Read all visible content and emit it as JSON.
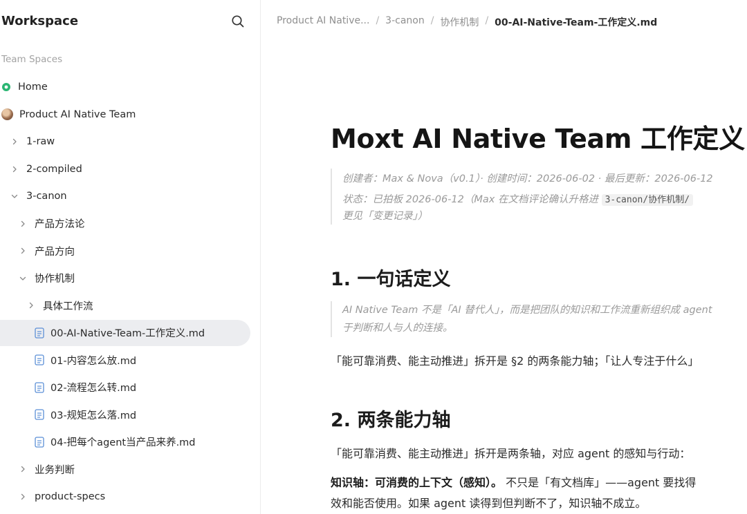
{
  "sidebar": {
    "workspace_title": "Workspace",
    "section_label": "Team Spaces",
    "items": [
      {
        "label": "Home",
        "kind": "home",
        "indent": 0,
        "chevron": "none"
      },
      {
        "label": "Product AI Native Team",
        "kind": "team",
        "indent": 0,
        "chevron": "none"
      },
      {
        "label": "1-raw",
        "kind": "folder",
        "indent": 1,
        "chevron": "right"
      },
      {
        "label": "2-compiled",
        "kind": "folder",
        "indent": 1,
        "chevron": "right"
      },
      {
        "label": "3-canon",
        "kind": "folder",
        "indent": 1,
        "chevron": "down"
      },
      {
        "label": "产品方法论",
        "kind": "folder",
        "indent": 2,
        "chevron": "right"
      },
      {
        "label": "产品方向",
        "kind": "folder",
        "indent": 2,
        "chevron": "right"
      },
      {
        "label": "协作机制",
        "kind": "folder",
        "indent": 2,
        "chevron": "down"
      },
      {
        "label": "具体工作流",
        "kind": "folder",
        "indent": 3,
        "chevron": "right"
      },
      {
        "label": "00-AI-Native-Team-工作定义.md",
        "kind": "file",
        "indent": 3,
        "active": true
      },
      {
        "label": "01-内容怎么放.md",
        "kind": "file",
        "indent": 3
      },
      {
        "label": "02-流程怎么转.md",
        "kind": "file",
        "indent": 3
      },
      {
        "label": "03-规矩怎么落.md",
        "kind": "file",
        "indent": 3
      },
      {
        "label": "04-把每个agent当产品来养.md",
        "kind": "file",
        "indent": 3
      },
      {
        "label": "业务判断",
        "kind": "folder",
        "indent": 2,
        "chevron": "right"
      },
      {
        "label": "product-specs",
        "kind": "folder",
        "indent": 2,
        "chevron": "right"
      }
    ]
  },
  "breadcrumb": {
    "items": [
      "Product AI Native...",
      "3-canon",
      "协作机制"
    ],
    "separator": "/",
    "current": "00-AI-Native-Team-工作定义.md"
  },
  "doc": {
    "title": "Moxt AI Native Team 工作定义",
    "meta_line1": "创建者：Max & Nova（v0.1）· 创建时间：2026-06-02 · 最后更新：2026-06-12",
    "meta_line2_prefix": "状态：已拍板 2026-06-12（Max 在文档评论确认升格进 ",
    "meta_line2_code": "3-canon/协作机制/",
    "meta_line3": "更见「变更记录」）",
    "h1": "1. 一句话定义",
    "quote_line1": "AI Native Team 不是「AI 替代人」，而是把团队的知识和工作流重新组织成 agent",
    "quote_line2": "于判断和人与人的连接。",
    "para1": "「能可靠消费、能主动推进」拆开是 §2 的两条能力轴；「让人专注于什么」",
    "h2": "2. 两条能力轴",
    "para2": "「能可靠消费、能主动推进」拆开是两条轴，对应 agent 的感知与行动：",
    "para3_bold": "知识轴：可消费的上下文（感知）。",
    "para3_rest": " 不只是「有文档库」——agent 要找得",
    "para4": "效和能否使用。如果 agent 读得到但判断不了，知识轴不成立。"
  },
  "colors": {
    "home_icon": "#2bb673",
    "active_row": "#ecedf0",
    "muted_text": "#9a9a9a"
  }
}
